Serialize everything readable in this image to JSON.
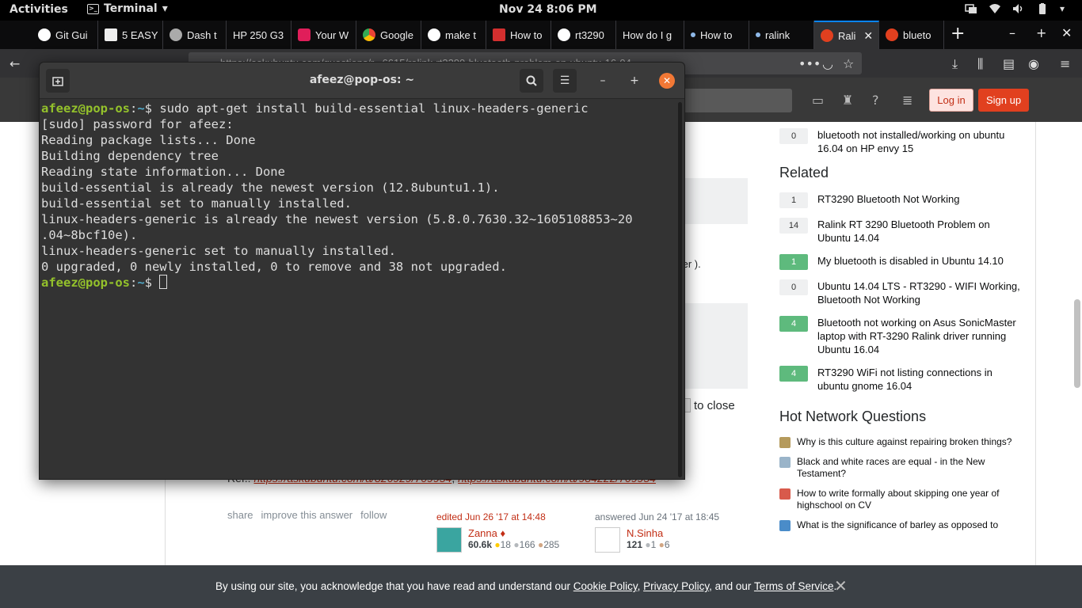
{
  "topbar": {
    "activities": "Activities",
    "app_name": "Terminal",
    "clock": "Nov 24   8:06 PM"
  },
  "browser": {
    "tabs": [
      {
        "label": "Git Gui",
        "color": "#ffffff"
      },
      {
        "label": "5 EASY",
        "color": "#eeeeee"
      },
      {
        "label": "Dash t",
        "color": "#aaaaaa"
      },
      {
        "label": "HP 250 G3",
        "color": "#0c0c0d"
      },
      {
        "label": "Your W",
        "color": "#e01e5a"
      },
      {
        "label": "Google",
        "color": "#4285f4"
      },
      {
        "label": "make t",
        "color": "#ffffff"
      },
      {
        "label": "How to",
        "color": "#d32f2f"
      },
      {
        "label": "rt3290",
        "color": "#ffffff"
      },
      {
        "label": "How do I g",
        "color": "#0c0c0d"
      },
      {
        "label": "How to",
        "color": "#8fb9e8"
      },
      {
        "label": "ralink",
        "color": "#8fb9e8"
      },
      {
        "label": "Rali",
        "color": "#e1401f"
      },
      {
        "label": "blueto",
        "color": "#e1401f"
      }
    ],
    "url": "https://askubuntu.com/questions/r...6615/ralink-rt3290-bluetooth-problem-on-ubuntu-16-04"
  },
  "terminal": {
    "title": "afeez@pop-os: ~",
    "prompt_user": "afeez@pop-os",
    "prompt_path": "~",
    "prompt_symbol": "$ ",
    "command": "sudo apt-get install build-essential linux-headers-generic",
    "output": [
      "[sudo] password for afeez:",
      "Reading package lists... Done",
      "Building dependency tree",
      "Reading state information... Done",
      "build-essential is already the newest version (12.8ubuntu1.1).",
      "build-essential set to manually installed.",
      "linux-headers-generic is already the newest version (5.8.0.7630.32~1605108853~20",
      ".04~8bcf10e).",
      "linux-headers-generic set to manually installed.",
      "0 upgraded, 0 newly installed, 0 to remove and 38 not upgraded."
    ]
  },
  "site": {
    "login": "Log in",
    "signup": "Sign up",
    "top_linked": {
      "score": "0",
      "title": "bluetooth not installed/working on ubuntu 16.04 on HP envy 15"
    },
    "related_heading": "Related",
    "related": [
      {
        "score": "1",
        "answered": false,
        "title": "RT3290 Bluetooth Not Working"
      },
      {
        "score": "14",
        "answered": false,
        "title": "Ralink RT 3290 Bluetooth Problem on Ubuntu 14.04"
      },
      {
        "score": "1",
        "answered": true,
        "title": "My bluetooth is disabled in Ubuntu 14.10"
      },
      {
        "score": "0",
        "answered": false,
        "title": "Ubuntu 14.04 LTS - RT3290 - WIFI Working, Bluetooth Not Working"
      },
      {
        "score": "4",
        "answered": true,
        "title": "Bluetooth not working on Asus SonicMaster laptop with RT-3290 Ralink driver running Ubuntu 16.04"
      },
      {
        "score": "4",
        "answered": true,
        "title": "RT3290 WiFi not listing connections in ubuntu gnome 16.04"
      }
    ],
    "hot_heading": "Hot Network Questions",
    "hot": [
      {
        "title": "Why is this culture against repairing broken things?",
        "color": "#b59a5c"
      },
      {
        "title": "Black and white races are equal - in the New Testament?",
        "color": "#9ab4c9"
      },
      {
        "title": "How to write formally about skipping one year of highschool on CV",
        "color": "#d85a4b"
      },
      {
        "title": "What is the significance of barley as opposed to",
        "color": "#4a8cc9"
      }
    ],
    "code_snippet": "ter ).",
    "close_snippet": "to close",
    "ref_prefix": "Ref.:",
    "ref_link_1": "https://askubuntu.com/a/826929/709954",
    "ref_sep": ",",
    "ref_link_2": "https://askubuntu.com/a/984222/709954",
    "post_menu": {
      "share": "share",
      "improve": "improve this answer",
      "follow": "follow"
    },
    "editor": {
      "when": "edited Jun 26 '17 at 14:48",
      "name": "Zanna ♦",
      "rep": "60.6k",
      "gold": "18",
      "silver": "166",
      "bronze": "285"
    },
    "answerer": {
      "when": "answered Jun 24 '17 at 18:45",
      "name": "N.Sinha",
      "rep": "121",
      "silver": "1",
      "bronze": "6"
    },
    "cookie": {
      "text_1": "By using our site, you acknowledge that you have read and understand our ",
      "link_1": "Cookie Policy",
      "sep_1": ", ",
      "link_2": "Privacy Policy",
      "sep_2": ", and our ",
      "link_3": "Terms of Service",
      "end": "."
    }
  }
}
